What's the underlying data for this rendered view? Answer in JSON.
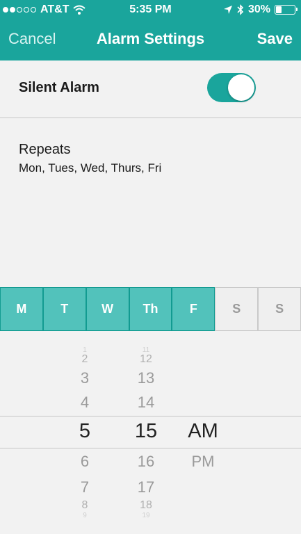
{
  "status_bar": {
    "carrier": "AT&T",
    "time": "5:35 PM",
    "battery_percent": "30%",
    "battery_level": 0.3,
    "icons": [
      "signal-dots-icon",
      "wifi-icon",
      "location-arrow-icon",
      "bluetooth-icon",
      "battery-icon"
    ]
  },
  "nav": {
    "cancel_label": "Cancel",
    "title": "Alarm Settings",
    "save_label": "Save"
  },
  "silent_alarm": {
    "label": "Silent Alarm",
    "enabled": true
  },
  "repeats": {
    "title": "Repeats",
    "days_summary": "Mon, Tues, Wed, Thurs, Fri"
  },
  "days": [
    {
      "label": "M",
      "active": true
    },
    {
      "label": "T",
      "active": true
    },
    {
      "label": "W",
      "active": true
    },
    {
      "label": "Th",
      "active": true
    },
    {
      "label": "F",
      "active": true
    },
    {
      "label": "S",
      "active": false
    },
    {
      "label": "S",
      "active": false
    }
  ],
  "time_picker": {
    "hours": [
      "1",
      "2",
      "3",
      "4",
      "5",
      "6",
      "7",
      "8",
      "9"
    ],
    "minutes": [
      "11",
      "12",
      "13",
      "14",
      "15",
      "16",
      "17",
      "18",
      "19"
    ],
    "meridiem": [
      "AM",
      "PM"
    ],
    "selected": {
      "hour": "5",
      "minute": "15",
      "meridiem": "AM"
    }
  },
  "colors": {
    "accent": "#1aa59c",
    "day_active": "#52c2bb",
    "day_inactive": "#efefef"
  }
}
